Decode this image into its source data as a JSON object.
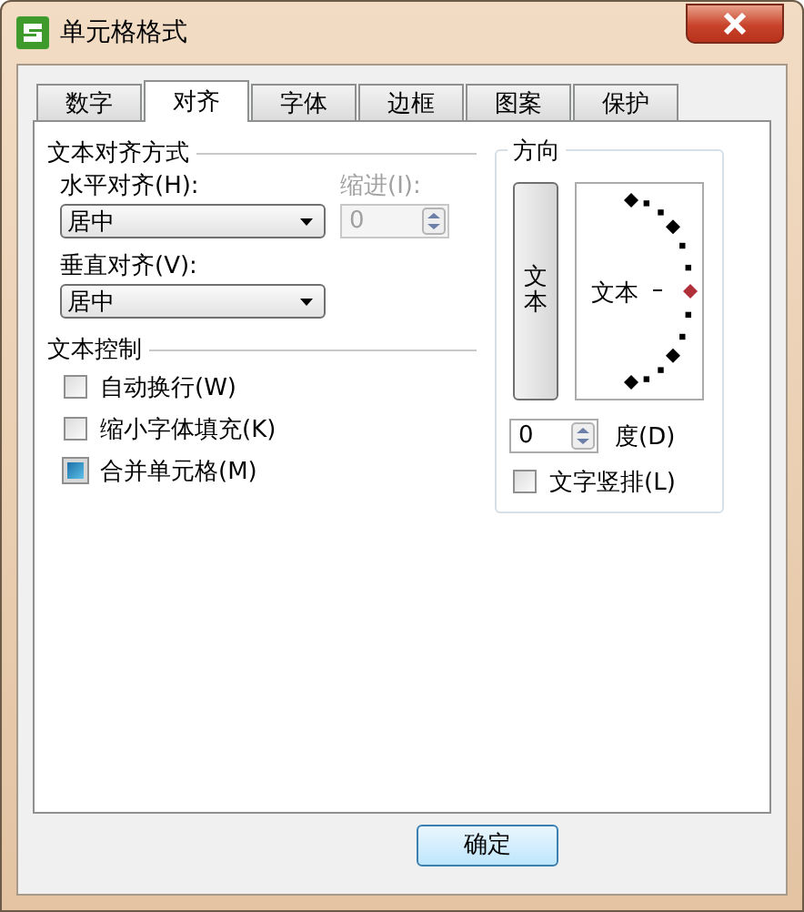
{
  "window": {
    "title": "单元格格式"
  },
  "tabs": [
    {
      "label": "数字",
      "selected": false
    },
    {
      "label": "对齐",
      "selected": true
    },
    {
      "label": "字体",
      "selected": false
    },
    {
      "label": "边框",
      "selected": false
    },
    {
      "label": "图案",
      "selected": false
    },
    {
      "label": "保护",
      "selected": false
    }
  ],
  "alignment": {
    "title": "文本对齐方式",
    "horizontal": {
      "label": "水平对齐(H):",
      "value": "居中"
    },
    "indent": {
      "label": "缩进(I):",
      "value": "0",
      "disabled": true
    },
    "vertical": {
      "label": "垂直对齐(V):",
      "value": "居中"
    }
  },
  "text_control": {
    "title": "文本控制",
    "options": [
      {
        "label": "自动换行(W)",
        "checked": false
      },
      {
        "label": "缩小字体填充(K)",
        "checked": false
      },
      {
        "label": "合并单元格(M)",
        "checked": true
      }
    ]
  },
  "orientation": {
    "title": "方向",
    "vertical_text": "文本",
    "dial_text": "文本",
    "degrees": {
      "value": "0",
      "label": "度(D)"
    },
    "stacked": {
      "label": "文字竖排(L)",
      "checked": false
    }
  },
  "buttons": [
    {
      "label": "确定"
    }
  ]
}
